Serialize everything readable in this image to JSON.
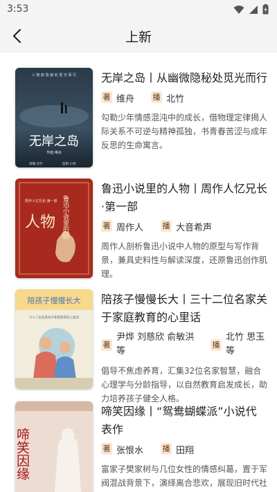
{
  "status_bar": {
    "time": "3:53"
  },
  "header": {
    "title": "上新"
  },
  "books": [
    {
      "title": "无岸之岛丨从幽微隐秘处觅光而行",
      "author_tag": "著",
      "author": "维舟",
      "narrator_tag": "播",
      "narrator": "北竹",
      "description": "勾勒少年情感混沌中的成长，借物理定律揭人际关系不可逆与精神孤独，书青春苦涩与成年反思的生命寓言。",
      "cover": {
        "top_text": "人 物 韵 隐 秘 处 觅 光 而 行",
        "main_text": "无岸之岛",
        "sub_text": "作者:维舟",
        "bottom_left": "演播:北竹",
        "bottom_right": "监制:小绿"
      }
    },
    {
      "title": "鲁迅小说里的人物丨周作人忆兄长·第一部",
      "author_tag": "著",
      "author": "周作人",
      "narrator_tag": "播",
      "narrator": "大音希声",
      "description": "周作人剖析鲁迅小说中人物的原型与写作背景，兼具史料性与解读深度，还原鲁迅创作肌理。",
      "cover": {
        "big_text": "人物",
        "side_text": "鲁迅小说里的",
        "sub_text": "周作人忆兄长·第一部"
      }
    },
    {
      "title": "陪孩子慢慢长大丨三十二位名家关于家庭教育的心里话",
      "author_tag": "著",
      "author": "尹烨 刘慈欣 俞敏洪等",
      "narrator_tag": "播",
      "narrator": "北竹 思玉等",
      "description": "倡导不焦虑养育，汇集32位名家智慧，融合心理学与分龄指导，以自然教育启发成长，助力培养孩子健全人格。",
      "cover": {
        "main_text": "陪孩子慢慢长大",
        "sub_text": "三十二位名家关于家庭教育的心里话"
      }
    },
    {
      "title": "啼笑因缘丨“鸳鸯蝴蝶派”小说代表作",
      "author_tag": "著",
      "author": "张恨水",
      "narrator_tag": "播",
      "narrator": "田翔",
      "description": "富家子樊家树与几位女性的情感纠葛，置于军阀混战背景下，演绎离合悲欢，展现旧时代社会风貌。",
      "cover": {
        "main_text": "啼笑因缘"
      }
    }
  ],
  "colors": {
    "tag_bg": "#fbe6d2",
    "header_bg": "#f4f4f4"
  }
}
